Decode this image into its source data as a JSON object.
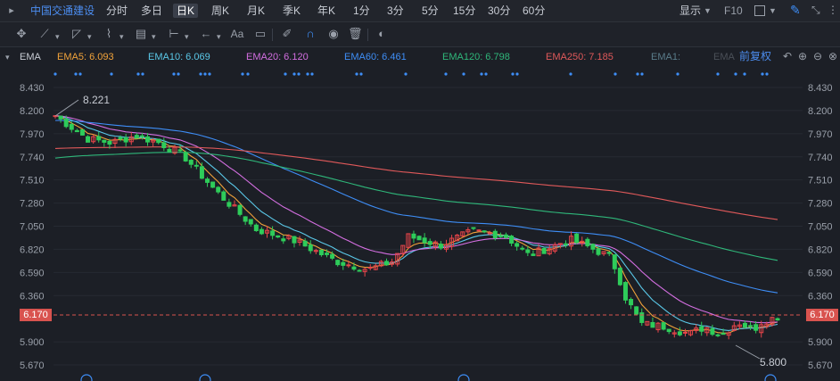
{
  "topbar": {
    "collapse_icon": "collapse-icon",
    "stock_name": "中国交通建设",
    "periods": [
      "分时",
      "多日",
      "日K",
      "周K",
      "月K",
      "季K",
      "年K",
      "1分",
      "3分",
      "5分",
      "15分",
      "30分",
      "60分"
    ],
    "active_period": "日K",
    "display_label": "显示",
    "f10_label": "F10"
  },
  "toolbar": {
    "icons": [
      "crosshair-icon",
      "line-tool-icon",
      "channel-tool-icon",
      "wave-tool-icon",
      "fib-tool-icon",
      "range-tool-icon",
      "arrow-tool-icon",
      "text-tool-icon",
      "comment-icon",
      "eraser-icon",
      "magnet-icon",
      "eye-icon",
      "trash-icon",
      "toggle-icon"
    ],
    "text_tool_label": "Aa"
  },
  "ema_bar": {
    "indicator_label": "EMA",
    "items": [
      {
        "label": "EMA5: 6.093",
        "color": "#f2a33a"
      },
      {
        "label": "EMA10: 6.069",
        "color": "#5ac8e8"
      },
      {
        "label": "EMA20: 6.120",
        "color": "#d36ee0"
      },
      {
        "label": "EMA60: 6.461",
        "color": "#3e8ef7"
      },
      {
        "label": "EMA120: 6.798",
        "color": "#2fb77a"
      },
      {
        "label": "EMA250: 7.185",
        "color": "#e0595a"
      },
      {
        "label": "EMA1:",
        "color": "#5a7c8a"
      },
      {
        "label": "EMA",
        "color": "#4b5058"
      }
    ],
    "adjust_label": "前复权"
  },
  "y_axis": {
    "labels": [
      "8.430",
      "8.200",
      "7.970",
      "7.740",
      "7.510",
      "7.280",
      "7.050",
      "6.820",
      "6.590",
      "6.360",
      "6.170",
      "5.900",
      "5.670"
    ],
    "min": 5.67,
    "max": 8.43
  },
  "current_price": {
    "label": "6.170",
    "value": 6.17
  },
  "annotations": {
    "high": "8.221",
    "low": "5.800"
  },
  "chart_data": {
    "type": "candlestick",
    "high_marker": 8.221,
    "low_marker": 5.8,
    "ema_last": {
      "EMA5": 6.093,
      "EMA10": 6.069,
      "EMA20": 6.12,
      "EMA60": 6.461,
      "EMA120": 6.798,
      "EMA250": 7.185
    }
  }
}
